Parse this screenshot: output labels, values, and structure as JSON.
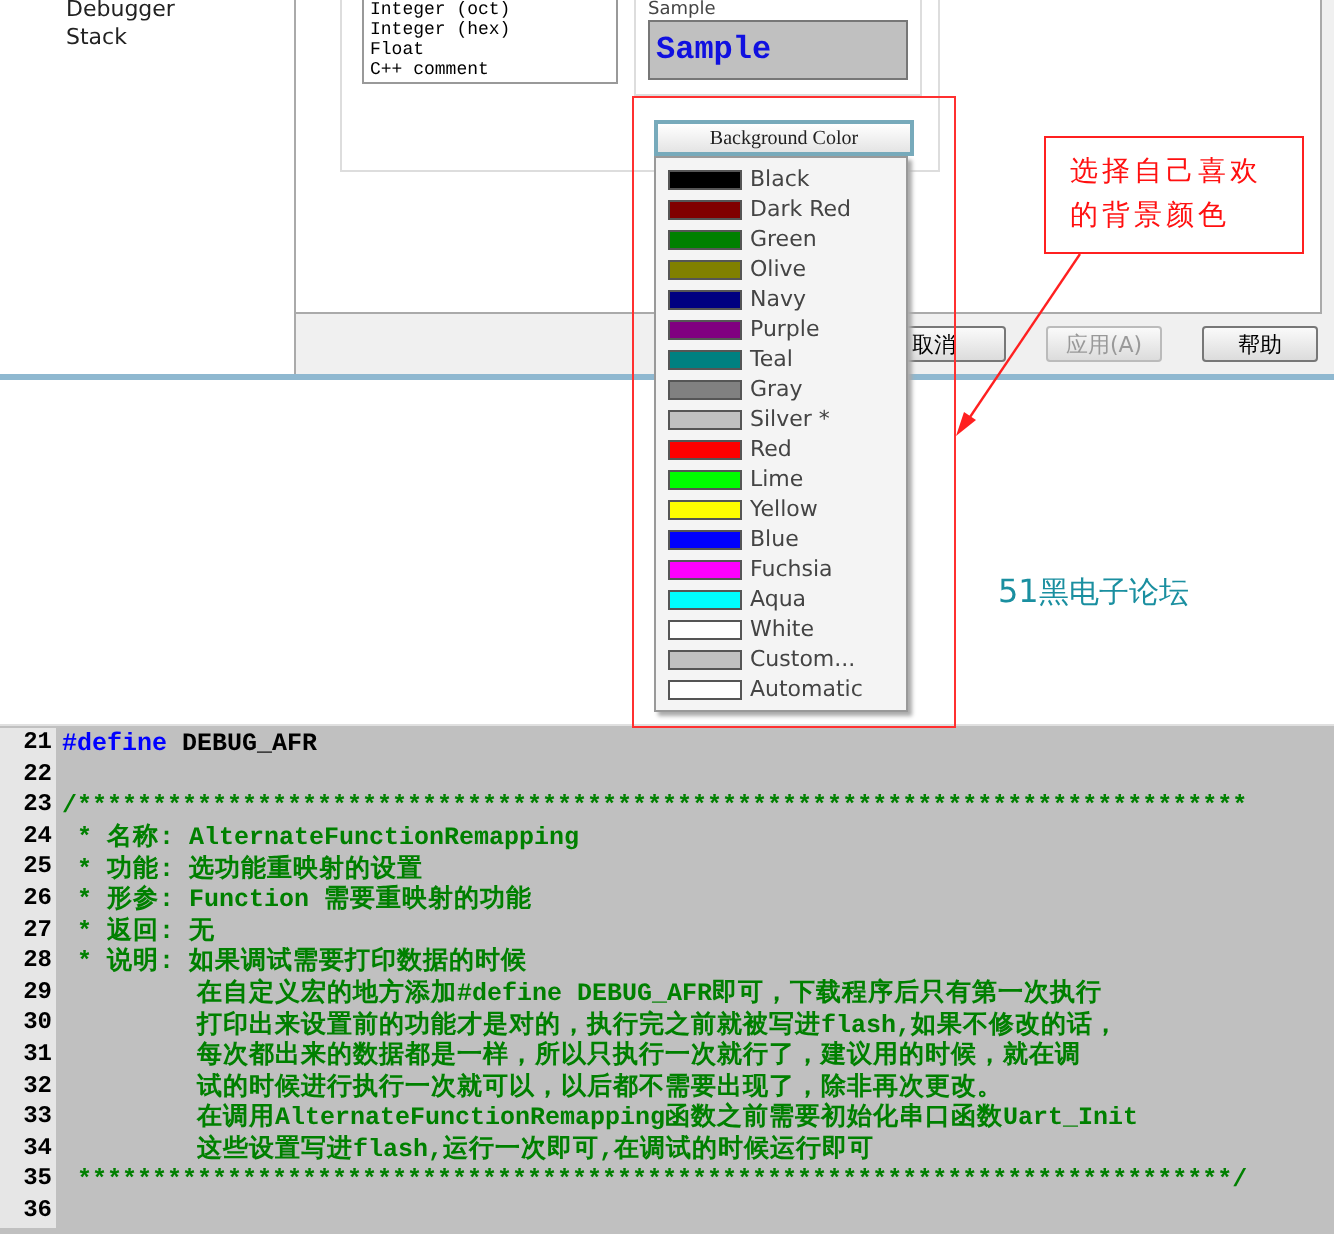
{
  "dialog": {
    "tree_items": [
      "Debugger",
      "Stack"
    ],
    "syntax_list": [
      "Integer (oct)",
      "Integer (hex)",
      "Float",
      "C++ comment"
    ],
    "sample_label": "Sample",
    "sample_text": "Sample",
    "buttons": [
      {
        "label": "取消",
        "disabled": false
      },
      {
        "label": "应用(A)",
        "disabled": true
      },
      {
        "label": "帮助",
        "disabled": false
      }
    ]
  },
  "color_menu": {
    "button": "Background Color",
    "items": [
      {
        "label": "Black",
        "color": "#000000"
      },
      {
        "label": "Dark Red",
        "color": "#800000"
      },
      {
        "label": "Green",
        "color": "#008000"
      },
      {
        "label": "Olive",
        "color": "#808000"
      },
      {
        "label": "Navy",
        "color": "#000080"
      },
      {
        "label": "Purple",
        "color": "#800080"
      },
      {
        "label": "Teal",
        "color": "#008080"
      },
      {
        "label": "Gray",
        "color": "#808080"
      },
      {
        "label": "Silver *",
        "color": "#c0c0c0"
      },
      {
        "label": "Red",
        "color": "#ff0000"
      },
      {
        "label": "Lime",
        "color": "#00ff00"
      },
      {
        "label": "Yellow",
        "color": "#ffff00"
      },
      {
        "label": "Blue",
        "color": "#0000ff"
      },
      {
        "label": "Fuchsia",
        "color": "#ff00ff"
      },
      {
        "label": "Aqua",
        "color": "#00ffff"
      },
      {
        "label": "White",
        "color": "#ffffff"
      },
      {
        "label": "Custom...",
        "color": "#c0c0c0"
      },
      {
        "label": "Automatic",
        "color": "#ffffff"
      }
    ]
  },
  "annotation": "选择自己喜欢的背景颜色",
  "forum_label": {
    "number": "51",
    "name": "黑电子论坛"
  },
  "code_lines": [
    {
      "number": "21",
      "kind": "directive",
      "keyword": "#define",
      "text": " DEBUG_AFR"
    },
    {
      "number": "22",
      "kind": "blank"
    },
    {
      "number": "23",
      "kind": "comment",
      "text": "/******************************************************************************"
    },
    {
      "number": "24",
      "kind": "comment",
      "text": " * 名称: AlternateFunctionRemapping"
    },
    {
      "number": "25",
      "kind": "comment",
      "text": " * 功能: 选功能重映射的设置"
    },
    {
      "number": "26",
      "kind": "comment",
      "text": " * 形参: Function 需要重映射的功能"
    },
    {
      "number": "27",
      "kind": "comment",
      "text": " * 返回: 无"
    },
    {
      "number": "28",
      "kind": "comment",
      "text": " * 说明: 如果调试需要打印数据的时候"
    },
    {
      "number": "29",
      "kind": "comment",
      "text": "         在自定义宏的地方添加#define DEBUG_AFR即可，下载程序后只有第一次执行"
    },
    {
      "number": "30",
      "kind": "comment",
      "text": "         打印出来设置前的功能才是对的，执行完之前就被写进flash,如果不修改的话，"
    },
    {
      "number": "31",
      "kind": "comment",
      "text": "         每次都出来的数据都是一样，所以只执行一次就行了，建议用的时候，就在调"
    },
    {
      "number": "32",
      "kind": "comment",
      "text": "         试的时候进行执行一次就可以，以后都不需要出现了，除非再次更改。"
    },
    {
      "number": "33",
      "kind": "comment",
      "text": "         在调用AlternateFunctionRemapping函数之前需要初始化串口函数Uart_Init"
    },
    {
      "number": "34",
      "kind": "comment",
      "text": "         这些设置写进flash,运行一次即可,在调试的时候运行即可"
    },
    {
      "number": "35",
      "kind": "comment",
      "text": " *****************************************************************************/"
    },
    {
      "number": "36",
      "kind": "blank"
    }
  ]
}
